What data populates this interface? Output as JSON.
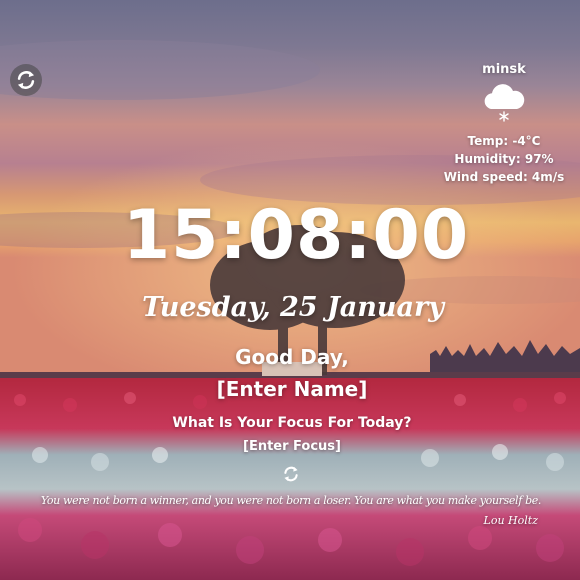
{
  "weather": {
    "city": "minsk",
    "icon": "snow-cloud-icon",
    "temperature": "Temp: -4°C",
    "humidity": "Humidity: 97%",
    "wind": "Wind speed: 4m/s"
  },
  "clock": {
    "time": "15:08:00",
    "date": "Tuesday, 25 January"
  },
  "greeting": {
    "text": "Good Day,",
    "name": "[Enter Name]"
  },
  "focus": {
    "question": "What Is Your Focus For Today?",
    "value": "[Enter Focus]"
  },
  "quote": {
    "text": "You were not born a winner, and you were not born a loser. You are what you make yourself be.",
    "author": "Lou Holtz"
  },
  "controls": {
    "refresh_background_icon": "refresh-icon",
    "refresh_quote_icon": "refresh-icon"
  },
  "colors": {
    "text": "#ffffff",
    "button_bg": "#4a4a4a"
  }
}
